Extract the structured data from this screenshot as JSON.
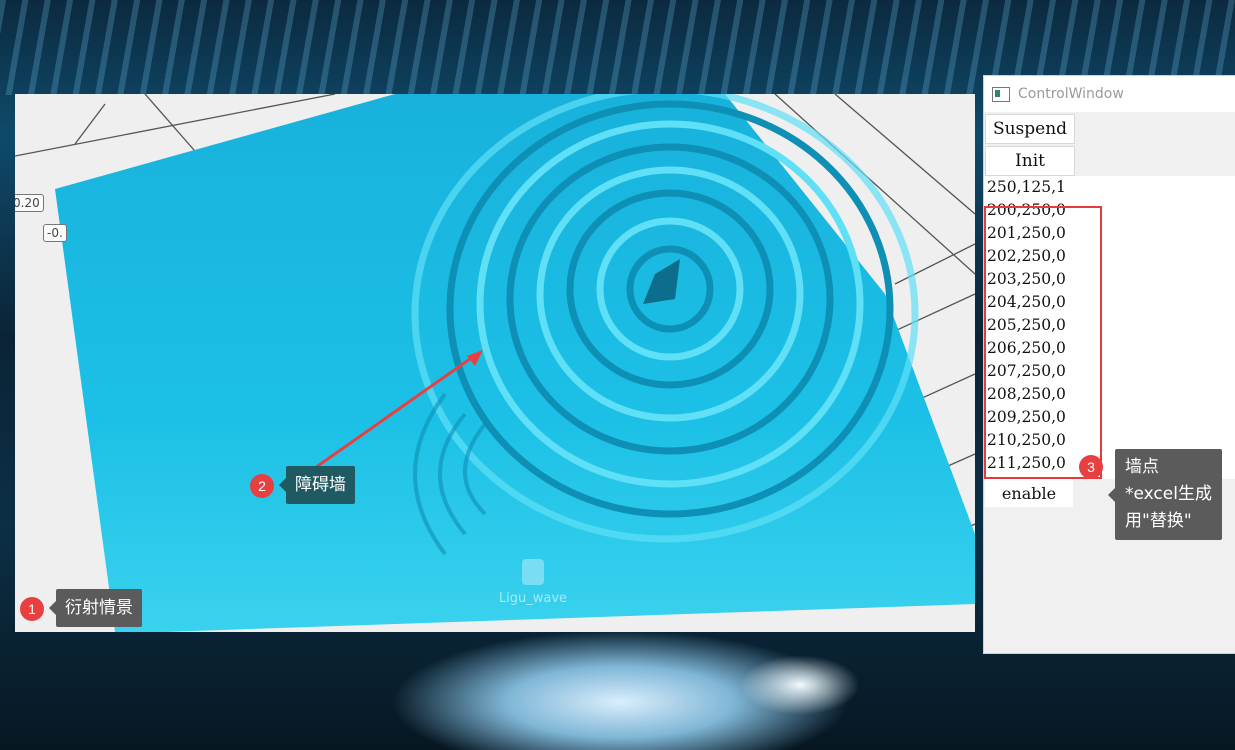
{
  "scene": {
    "watermark": "Ligu_wave",
    "tick_labels": [
      "0.20",
      "-0."
    ]
  },
  "control_window": {
    "title": "ControlWindow",
    "buttons": {
      "suspend": "Suspend",
      "init": "Init",
      "enable": "enable"
    },
    "source_point": "250,125,1",
    "wall_points": [
      "200,250,0",
      "201,250,0",
      "202,250,0",
      "203,250,0",
      "204,250,0",
      "205,250,0",
      "206,250,0",
      "207,250,0",
      "208,250,0",
      "209,250,0",
      "210,250,0",
      "211,250,0"
    ]
  },
  "annotations": {
    "a1": {
      "number": "1",
      "text": "衍射情景"
    },
    "a2": {
      "number": "2",
      "text": "障碍墙"
    },
    "a3": {
      "number": "3",
      "line1": "墙点",
      "line2": "*excel生成",
      "line3": "用\"替换\""
    }
  },
  "colors": {
    "accent_red": "#e84040",
    "wave": "#19b8dd",
    "tooltip": "#5b5b5b",
    "tooltip_teal": "#1f5a62"
  }
}
